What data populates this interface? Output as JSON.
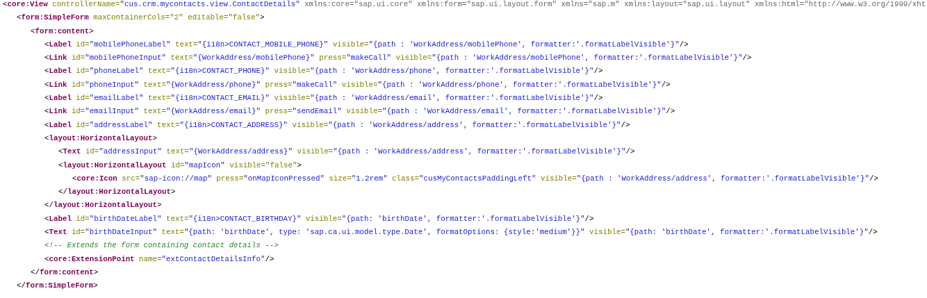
{
  "code": [
    {
      "tokens": [
        {
          "kind": "p",
          "text": "<"
        },
        {
          "kind": "tag",
          "text": "core:View"
        },
        {
          "kind": "attr",
          "text": " controllerName="
        },
        {
          "kind": "val",
          "text": "\"cus.crm.mycontacts.view.ContactDetails\""
        },
        {
          "kind": "ns",
          "text": " xmlns:core=\"sap.ui.core\" xmlns:form=\"sap.ui.layout.form\" xmlns=\"sap.m\" xmlns:layout=\"sap.ui.layout\" xmlns:html=\"http://www.w3.org/1999/xht"
        }
      ],
      "children": [
        {
          "tokens": [
            {
              "kind": "p",
              "text": "<"
            },
            {
              "kind": "tag",
              "text": "form:SimpleForm"
            },
            {
              "kind": "attr",
              "text": " maxContainerCols=\"2\" editable=\"false\""
            },
            {
              "kind": "p",
              "text": ">"
            }
          ],
          "children": [
            {
              "tokens": [
                {
                  "kind": "p",
                  "text": "<"
                },
                {
                  "kind": "tag",
                  "text": "form:content"
                },
                {
                  "kind": "p",
                  "text": ">"
                }
              ],
              "children": [
                {
                  "tokens": [
                    {
                      "kind": "p",
                      "text": "<"
                    },
                    {
                      "kind": "tag",
                      "text": "Label"
                    },
                    {
                      "kind": "attr",
                      "text": " id="
                    },
                    {
                      "kind": "val",
                      "text": "\"mobilePhoneLabel\""
                    },
                    {
                      "kind": "attr",
                      "text": " text="
                    },
                    {
                      "kind": "val",
                      "text": "\"{i18n>CONTACT_MOBILE_PHONE}\""
                    },
                    {
                      "kind": "attr",
                      "text": " visible="
                    },
                    {
                      "kind": "val",
                      "text": "\"{path : 'WorkAddress/mobilePhone', formatter:'.formatLabelVisible'}\""
                    },
                    {
                      "kind": "p",
                      "text": "/>"
                    }
                  ]
                },
                {
                  "tokens": [
                    {
                      "kind": "p",
                      "text": "<"
                    },
                    {
                      "kind": "tag",
                      "text": "Link"
                    },
                    {
                      "kind": "attr",
                      "text": " id="
                    },
                    {
                      "kind": "val",
                      "text": "\"mobilePhoneInput\""
                    },
                    {
                      "kind": "attr",
                      "text": " text="
                    },
                    {
                      "kind": "val",
                      "text": "\"{WorkAddress/mobilePhone}\""
                    },
                    {
                      "kind": "attr",
                      "text": " press="
                    },
                    {
                      "kind": "val",
                      "text": "\"makeCall\""
                    },
                    {
                      "kind": "attr",
                      "text": " visible="
                    },
                    {
                      "kind": "val",
                      "text": "\"{path : 'WorkAddress/mobilePhone', formatter:'.formatLabelVisible'}\""
                    },
                    {
                      "kind": "p",
                      "text": "/>"
                    }
                  ]
                },
                {
                  "tokens": [
                    {
                      "kind": "p",
                      "text": "<"
                    },
                    {
                      "kind": "tag",
                      "text": "Label"
                    },
                    {
                      "kind": "attr",
                      "text": " id="
                    },
                    {
                      "kind": "val",
                      "text": "\"phoneLabel\""
                    },
                    {
                      "kind": "attr",
                      "text": " text="
                    },
                    {
                      "kind": "val",
                      "text": "\"{i18n>CONTACT_PHONE}\""
                    },
                    {
                      "kind": "attr",
                      "text": " visible="
                    },
                    {
                      "kind": "val",
                      "text": "\"{path : 'WorkAddress/phone', formatter:'.formatLabelVisible'}\""
                    },
                    {
                      "kind": "p",
                      "text": "/>"
                    }
                  ]
                },
                {
                  "tokens": [
                    {
                      "kind": "p",
                      "text": "<"
                    },
                    {
                      "kind": "tag",
                      "text": "Link"
                    },
                    {
                      "kind": "attr",
                      "text": " id="
                    },
                    {
                      "kind": "val",
                      "text": "\"phoneInput\""
                    },
                    {
                      "kind": "attr",
                      "text": " text="
                    },
                    {
                      "kind": "val",
                      "text": "\"{WorkAddress/phone}\""
                    },
                    {
                      "kind": "attr",
                      "text": " press="
                    },
                    {
                      "kind": "val",
                      "text": "\"makeCall\""
                    },
                    {
                      "kind": "attr",
                      "text": " visible="
                    },
                    {
                      "kind": "val",
                      "text": "\"{path : 'WorkAddress/phone', formatter:'.formatLabelVisible'}\""
                    },
                    {
                      "kind": "p",
                      "text": "/>"
                    }
                  ]
                },
                {
                  "tokens": [
                    {
                      "kind": "p",
                      "text": "<"
                    },
                    {
                      "kind": "tag",
                      "text": "Label"
                    },
                    {
                      "kind": "attr",
                      "text": " id="
                    },
                    {
                      "kind": "val",
                      "text": "\"emailLabel\""
                    },
                    {
                      "kind": "attr",
                      "text": " text="
                    },
                    {
                      "kind": "val",
                      "text": "\"{i18n>CONTACT_EMAIL}\""
                    },
                    {
                      "kind": "attr",
                      "text": " visible="
                    },
                    {
                      "kind": "val",
                      "text": "\"{path : 'WorkAddress/email', formatter:'.formatLabelVisible'}\""
                    },
                    {
                      "kind": "p",
                      "text": "/>"
                    }
                  ]
                },
                {
                  "tokens": [
                    {
                      "kind": "p",
                      "text": "<"
                    },
                    {
                      "kind": "tag",
                      "text": "Link"
                    },
                    {
                      "kind": "attr",
                      "text": " id="
                    },
                    {
                      "kind": "val",
                      "text": "\"emailInput\""
                    },
                    {
                      "kind": "attr",
                      "text": " text="
                    },
                    {
                      "kind": "val",
                      "text": "\"{WorkAddress/email}\""
                    },
                    {
                      "kind": "attr",
                      "text": " press="
                    },
                    {
                      "kind": "val",
                      "text": "\"sendEmail\""
                    },
                    {
                      "kind": "attr",
                      "text": " visible="
                    },
                    {
                      "kind": "val",
                      "text": "\"{path : 'WorkAddress/email', formatter:'.formatLabelVisible'}\""
                    },
                    {
                      "kind": "p",
                      "text": "/>"
                    }
                  ]
                },
                {
                  "tokens": [
                    {
                      "kind": "p",
                      "text": "<"
                    },
                    {
                      "kind": "tag",
                      "text": "Label"
                    },
                    {
                      "kind": "attr",
                      "text": " id="
                    },
                    {
                      "kind": "val",
                      "text": "\"addressLabel\""
                    },
                    {
                      "kind": "attr",
                      "text": " text="
                    },
                    {
                      "kind": "val",
                      "text": "\"{i18n>CONTACT_ADDRESS}\""
                    },
                    {
                      "kind": "attr",
                      "text": " visible="
                    },
                    {
                      "kind": "val",
                      "text": "\"{path : 'WorkAddress/address', formatter:'.formatLabelVisible'}\""
                    },
                    {
                      "kind": "p",
                      "text": "/>"
                    }
                  ]
                },
                {
                  "tokens": [
                    {
                      "kind": "p",
                      "text": "<"
                    },
                    {
                      "kind": "tag",
                      "text": "layout:HorizontalLayout"
                    },
                    {
                      "kind": "p",
                      "text": ">"
                    }
                  ],
                  "children": [
                    {
                      "tokens": [
                        {
                          "kind": "p",
                          "text": "<"
                        },
                        {
                          "kind": "tag",
                          "text": "Text"
                        },
                        {
                          "kind": "attr",
                          "text": " id="
                        },
                        {
                          "kind": "val",
                          "text": "\"addressInput\""
                        },
                        {
                          "kind": "attr",
                          "text": " text="
                        },
                        {
                          "kind": "val",
                          "text": "\"{WorkAddress/address}\""
                        },
                        {
                          "kind": "attr",
                          "text": " visible="
                        },
                        {
                          "kind": "val",
                          "text": "\"{path : 'WorkAddress/address', formatter:'.formatLabelVisible'}\""
                        },
                        {
                          "kind": "p",
                          "text": "/>"
                        }
                      ]
                    },
                    {
                      "tokens": [
                        {
                          "kind": "p",
                          "text": "<"
                        },
                        {
                          "kind": "tag",
                          "text": "layout:HorizontalLayout"
                        },
                        {
                          "kind": "attr",
                          "text": " id="
                        },
                        {
                          "kind": "val",
                          "text": "\"mapIcon\""
                        },
                        {
                          "kind": "attr",
                          "text": " visible=\"false\""
                        },
                        {
                          "kind": "p",
                          "text": ">"
                        }
                      ],
                      "children": [
                        {
                          "tokens": [
                            {
                              "kind": "p",
                              "text": "<"
                            },
                            {
                              "kind": "tag",
                              "text": "core:Icon"
                            },
                            {
                              "kind": "attr",
                              "text": " src="
                            },
                            {
                              "kind": "val",
                              "text": "\"sap-icon://map\""
                            },
                            {
                              "kind": "attr",
                              "text": " press="
                            },
                            {
                              "kind": "val",
                              "text": "\"onMapIconPressed\""
                            },
                            {
                              "kind": "attr",
                              "text": " size="
                            },
                            {
                              "kind": "val",
                              "text": "\"1.2rem\""
                            },
                            {
                              "kind": "attr",
                              "text": " class="
                            },
                            {
                              "kind": "val",
                              "text": "\"cusMyContactsPaddingLeft\""
                            },
                            {
                              "kind": "attr",
                              "text": " visible="
                            },
                            {
                              "kind": "val",
                              "text": "\"{path : 'WorkAddress/address', formatter:'.formatLabelVisible'}\""
                            },
                            {
                              "kind": "p",
                              "text": "/>"
                            }
                          ]
                        }
                      ]
                    },
                    {
                      "tokens": [
                        {
                          "kind": "p",
                          "text": "</"
                        },
                        {
                          "kind": "tag",
                          "text": "layout:HorizontalLayout"
                        },
                        {
                          "kind": "p",
                          "text": ">"
                        }
                      ]
                    }
                  ]
                },
                {
                  "tokens": [
                    {
                      "kind": "p",
                      "text": "</"
                    },
                    {
                      "kind": "tag",
                      "text": "layout:HorizontalLayout"
                    },
                    {
                      "kind": "p",
                      "text": ">"
                    }
                  ]
                },
                {
                  "tokens": [
                    {
                      "kind": "p",
                      "text": "<"
                    },
                    {
                      "kind": "tag",
                      "text": "Label"
                    },
                    {
                      "kind": "attr",
                      "text": " id="
                    },
                    {
                      "kind": "val",
                      "text": "\"birthDateLabel\""
                    },
                    {
                      "kind": "attr",
                      "text": " text="
                    },
                    {
                      "kind": "val",
                      "text": "\"{i18n>CONTACT_BIRTHDAY}\""
                    },
                    {
                      "kind": "attr",
                      "text": " visible="
                    },
                    {
                      "kind": "val",
                      "text": "\"{path: 'birthDate', formatter:'.formatLabelVisible'}\""
                    },
                    {
                      "kind": "p",
                      "text": "/>"
                    }
                  ]
                },
                {
                  "tokens": [
                    {
                      "kind": "p",
                      "text": "<"
                    },
                    {
                      "kind": "tag",
                      "text": "Text"
                    },
                    {
                      "kind": "attr",
                      "text": " id="
                    },
                    {
                      "kind": "val",
                      "text": "\"birthDateInput\""
                    },
                    {
                      "kind": "attr",
                      "text": " text="
                    },
                    {
                      "kind": "val",
                      "text": "\"{path: 'birthDate', type: 'sap.ca.ui.model.type.Date', formatOptions: {style:'medium'}}\""
                    },
                    {
                      "kind": "attr",
                      "text": " visible="
                    },
                    {
                      "kind": "val",
                      "text": "\"{path: 'birthDate', formatter:'.formatLabelVisible'}\""
                    },
                    {
                      "kind": "p",
                      "text": "/>"
                    }
                  ]
                },
                {
                  "tokens": [
                    {
                      "kind": "comment",
                      "text": "<!-- Extends the form containing contact details -->"
                    }
                  ]
                },
                {
                  "tokens": [
                    {
                      "kind": "p",
                      "text": "<"
                    },
                    {
                      "kind": "tag",
                      "text": "core:ExtensionPoint"
                    },
                    {
                      "kind": "attr",
                      "text": " name="
                    },
                    {
                      "kind": "val",
                      "text": "\"extContactDetailsInfo\""
                    },
                    {
                      "kind": "p",
                      "text": "/>"
                    }
                  ]
                }
              ]
            },
            {
              "tokens": [
                {
                  "kind": "p",
                  "text": "</"
                },
                {
                  "kind": "tag",
                  "text": "form:content"
                },
                {
                  "kind": "p",
                  "text": ">"
                }
              ]
            }
          ]
        },
        {
          "tokens": [
            {
              "kind": "p",
              "text": "</"
            },
            {
              "kind": "tag",
              "text": "form:SimpleForm"
            },
            {
              "kind": "p",
              "text": ">"
            }
          ]
        }
      ]
    }
  ]
}
